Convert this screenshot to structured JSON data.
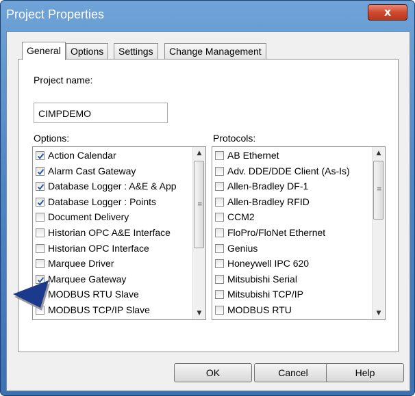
{
  "window": {
    "title": "Project Properties",
    "close_symbol": "x"
  },
  "tabs": [
    "General",
    "Options",
    "Settings",
    "Change Management"
  ],
  "general": {
    "project_name_label": "Project name:",
    "project_name_value": "CIMPDEMO",
    "options_label": "Options:",
    "protocols_label": "Protocols:"
  },
  "options_list": [
    {
      "label": "Action Calendar",
      "checked": true
    },
    {
      "label": "Alarm Cast Gateway",
      "checked": true
    },
    {
      "label": "Database Logger : A&E & App",
      "checked": true
    },
    {
      "label": "Database Logger : Points",
      "checked": true
    },
    {
      "label": "Document Delivery",
      "checked": false
    },
    {
      "label": "Historian OPC A&E Interface",
      "checked": false
    },
    {
      "label": "Historian OPC Interface",
      "checked": false
    },
    {
      "label": "Marquee Driver",
      "checked": false
    },
    {
      "label": "Marquee Gateway",
      "checked": true
    },
    {
      "label": "MODBUS RTU Slave",
      "checked": false
    },
    {
      "label": "MODBUS TCP/IP Slave",
      "checked": false
    }
  ],
  "protocols_list": [
    {
      "label": "AB Ethernet",
      "checked": false
    },
    {
      "label": "Adv. DDE/DDE Client (As-Is)",
      "checked": false
    },
    {
      "label": "Allen-Bradley DF-1",
      "checked": false
    },
    {
      "label": "Allen-Bradley RFID",
      "checked": false
    },
    {
      "label": "CCM2",
      "checked": false
    },
    {
      "label": "FloPro/FloNet Ethernet",
      "checked": false
    },
    {
      "label": "Genius",
      "checked": false
    },
    {
      "label": "Honeywell IPC 620",
      "checked": false
    },
    {
      "label": "Mitsubishi Serial",
      "checked": false
    },
    {
      "label": "Mitsubishi TCP/IP",
      "checked": false
    },
    {
      "label": "MODBUS RTU",
      "checked": false
    }
  ],
  "buttons": {
    "ok": "OK",
    "cancel": "Cancel",
    "help": "Help"
  },
  "colors": {
    "titlebar": "#4f86c4",
    "check": "#2a5a9e",
    "pointer": "#1c3a8c"
  }
}
